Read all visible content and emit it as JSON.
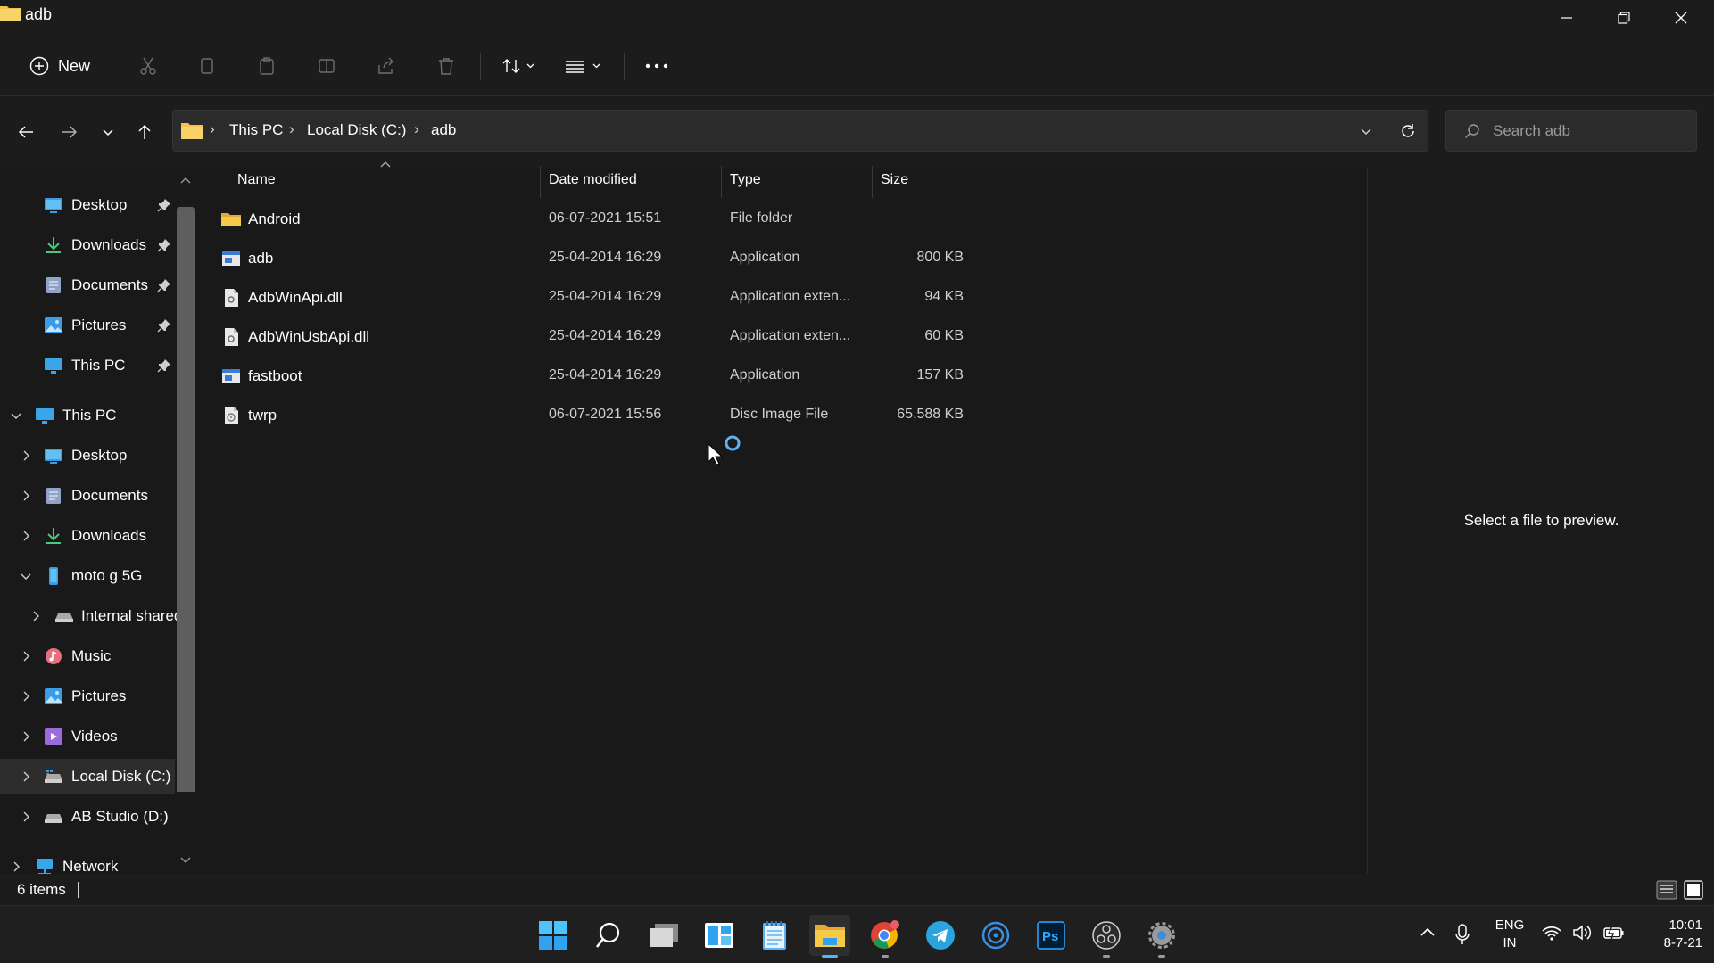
{
  "window": {
    "title": "adb"
  },
  "toolbar": {
    "new_label": "New",
    "icons": [
      "cut-icon",
      "copy-icon",
      "paste-icon",
      "rename-icon",
      "share-icon",
      "delete-icon",
      "sort-icon",
      "view-icon",
      "more-icon"
    ]
  },
  "address": {
    "crumbs": [
      "This PC",
      "Local Disk (C:)",
      "adb"
    ],
    "search_placeholder": "Search adb"
  },
  "nav": {
    "quick_access": [
      {
        "label": "Desktop",
        "icon": "desktop-icon",
        "pinned": true
      },
      {
        "label": "Downloads",
        "icon": "downloads-icon",
        "pinned": true
      },
      {
        "label": "Documents",
        "icon": "documents-icon",
        "pinned": true
      },
      {
        "label": "Pictures",
        "icon": "pictures-icon",
        "pinned": true
      },
      {
        "label": "This PC",
        "icon": "computer-icon",
        "pinned": true
      }
    ],
    "this_pc": "This PC",
    "tree": [
      {
        "label": "Desktop"
      },
      {
        "label": "Documents"
      },
      {
        "label": "Downloads"
      },
      {
        "label": "moto g 5G"
      },
      {
        "label": "Internal shared"
      },
      {
        "label": "Music"
      },
      {
        "label": "Pictures"
      },
      {
        "label": "Videos"
      },
      {
        "label": "Local Disk (C:)"
      },
      {
        "label": "AB Studio (D:)"
      }
    ],
    "network": "Network"
  },
  "columns": {
    "name": "Name",
    "date": "Date modified",
    "type": "Type",
    "size": "Size"
  },
  "files": [
    {
      "name": "Android",
      "date": "06-07-2021 15:51",
      "type": "File folder",
      "size": "",
      "icon": "folder-icon"
    },
    {
      "name": "adb",
      "date": "25-04-2014 16:29",
      "type": "Application",
      "size": "800 KB",
      "icon": "application-icon"
    },
    {
      "name": "AdbWinApi.dll",
      "date": "25-04-2014 16:29",
      "type": "Application exten...",
      "size": "94 KB",
      "icon": "dll-file-icon"
    },
    {
      "name": "AdbWinUsbApi.dll",
      "date": "25-04-2014 16:29",
      "type": "Application exten...",
      "size": "60 KB",
      "icon": "dll-file-icon"
    },
    {
      "name": "fastboot",
      "date": "25-04-2014 16:29",
      "type": "Application",
      "size": "157 KB",
      "icon": "application-icon"
    },
    {
      "name": "twrp",
      "date": "06-07-2021 15:56",
      "type": "Disc Image File",
      "size": "65,588 KB",
      "icon": "disc-image-icon"
    }
  ],
  "preview": {
    "text": "Select a file to preview."
  },
  "status": {
    "item_count": "6 items"
  },
  "taskbar": {
    "apps": [
      "start-icon",
      "search-icon",
      "task-view-icon",
      "widgets-icon",
      "notepad-icon",
      "file-explorer-icon",
      "chrome-icon",
      "telegram-icon",
      "cortana-icon",
      "photoshop-icon",
      "obs-icon",
      "settings-icon"
    ],
    "lang_line1": "ENG",
    "lang_line2": "IN",
    "time": "10:01",
    "date": "8-7-21"
  },
  "colors": {
    "background": "#191919",
    "accent": "#5fb2f2",
    "folder": "#f2c14e"
  }
}
